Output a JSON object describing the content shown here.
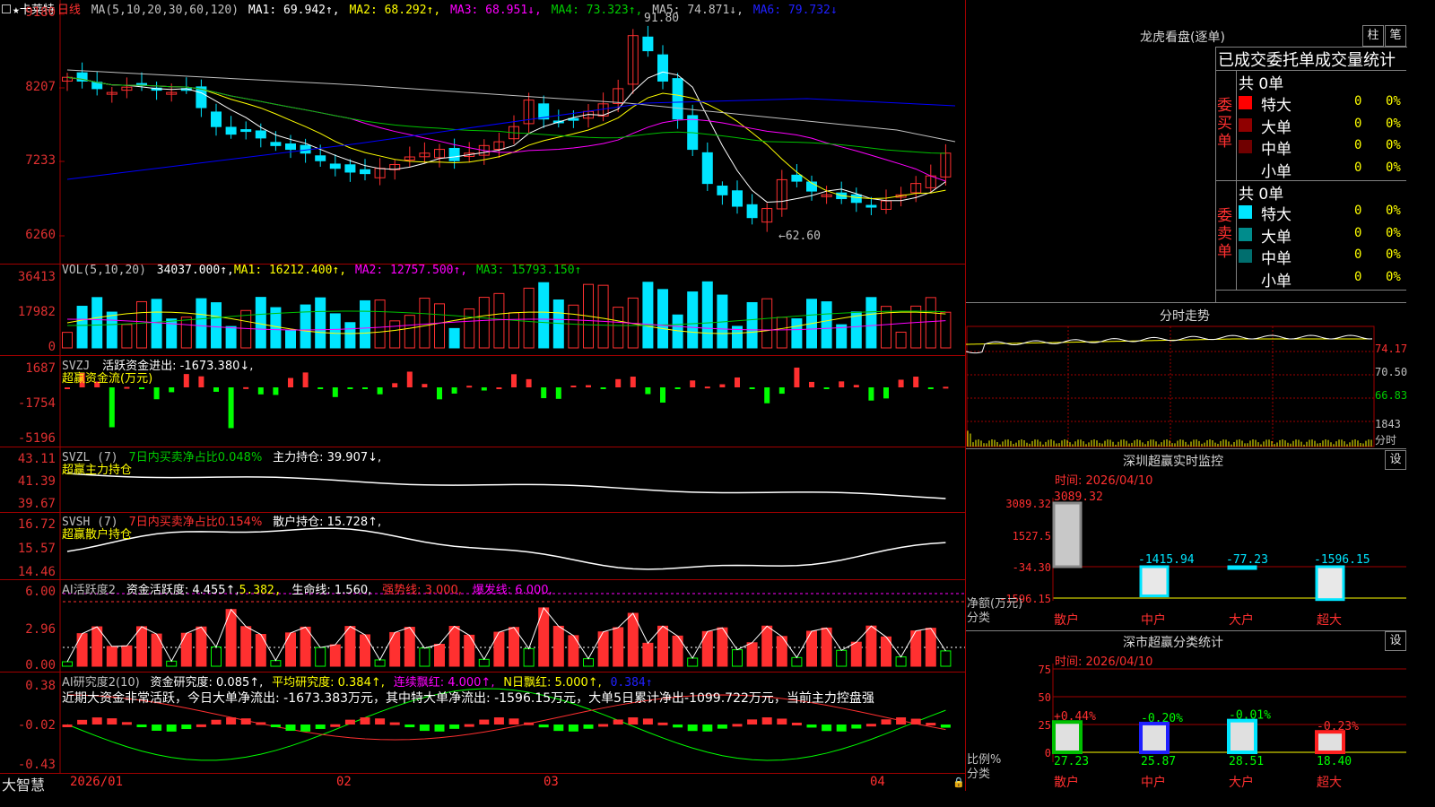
{
  "colors": {
    "up": "#ff3030",
    "down": "#00e5ff",
    "vol_up": "#ff3030",
    "grid": "#a00000",
    "ma1": "#ffffff",
    "ma2": "#ffff00",
    "ma3": "#ff00ff",
    "ma4": "#00c000",
    "ma5": "#c0c0c0",
    "ma6": "#0000ff",
    "green": "#00ff00",
    "yellow": "#ffff00",
    "magenta": "#ff00ff",
    "cyan": "#00e5ff"
  },
  "header": {
    "icon": "square-icon",
    "star": "★",
    "name": "卡莱特",
    "period": "日线",
    "ma_label": "MA(5,10,20,30,60,120)",
    "ma1": "MA1: 69.942↑,",
    "ma2": "MA2: 68.292↑,",
    "ma3": "MA3: 68.951↓,",
    "ma4": "MA4: 73.323↑,",
    "ma5": "MA5: 74.871↓,",
    "ma6": "MA6: 79.732↓"
  },
  "price_axis": {
    "ticks": [
      "9180",
      "8207",
      "7233",
      "6260"
    ]
  },
  "annotations": {
    "high": "91.80",
    "low": "←62.60"
  },
  "vol": {
    "label": "VOL(5,10,20)",
    "value": "34037.000↑,",
    "ma1": "MA1: 16212.400↑,",
    "ma2": "MA2: 12757.500↑,",
    "ma3": "MA3: 15793.150↑",
    "ticks": [
      "36413",
      "17982",
      "0"
    ]
  },
  "svzj": {
    "label": "SVZJ",
    "text": "活跃资金进出: -1673.380↓,",
    "sub": "超赢资金流(万元)",
    "ticks": [
      "1687",
      "-1754",
      "-5196"
    ]
  },
  "svzl": {
    "label": "SVZL (7)",
    "text1": "7日内买卖净占比0.048%",
    "text2": "主力持仓: 39.907↓,",
    "sub": "超赢主力持仓",
    "ticks": [
      "43.11",
      "41.39",
      "39.67"
    ]
  },
  "svsh": {
    "label": "SVSH (7)",
    "text1": "7日内买卖净占比0.154%",
    "text2": "散户持仓: 15.728↑,",
    "sub": "超赢散户持仓",
    "ticks": [
      "16.72",
      "15.57",
      "14.46"
    ]
  },
  "ai2": {
    "label": "AI活跃度2",
    "text1": "资金活跃度: 4.455↑,",
    "text2": "5.382,",
    "text3": "生命线: 1.560,",
    "text4": "强势线: 3.000,",
    "text5": "爆发线: 6.000,",
    "ticks": [
      "6.00",
      "2.96",
      "0.00"
    ]
  },
  "ai_res": {
    "label": "AI研究度2(10)",
    "text1": "资金研究度: 0.085↑,",
    "text2": "平均研究度: 0.384↑,",
    "text3": "连续飘红: 4.000↑,",
    "text4": "N日飘红: 5.000↑,",
    "text5": "0.384↑",
    "comment": "近期大资金非常活跃，今日大单净流出: -1673.383万元，其中特大单净流出: -1596.15万元，大单5日累计净出-1099.722万元，当前主力控盘强",
    "ticks": [
      "0.38",
      "-0.02",
      "-0.43"
    ]
  },
  "footer": {
    "brand": "大智慧",
    "dates": [
      "2026/01",
      "02",
      "03",
      "04"
    ],
    "lock": "lock-icon"
  },
  "lhb": {
    "title": "龙虎看盘(逐单)",
    "btn1": "柱",
    "btn2": "笔",
    "header": "已成交委托单成交量统计",
    "buy_title": "共 0单",
    "buy_side": "委买单",
    "buy_rows": [
      {
        "label": "特大",
        "v": "0",
        "p": "0%",
        "c": "#ff0000"
      },
      {
        "label": "大单",
        "v": "0",
        "p": "0%",
        "c": "#900000"
      },
      {
        "label": "中单",
        "v": "0",
        "p": "0%",
        "c": "#700000"
      },
      {
        "label": "小单",
        "v": "0",
        "p": "0%",
        "c": ""
      }
    ],
    "sell_title": "共 0单",
    "sell_side": "委卖单",
    "sell_rows": [
      {
        "label": "特大",
        "v": "0",
        "p": "0%",
        "c": "#00e5ff"
      },
      {
        "label": "大单",
        "v": "0",
        "p": "0%",
        "c": "#008c8c"
      },
      {
        "label": "中单",
        "v": "0",
        "p": "0%",
        "c": "#006e6e"
      },
      {
        "label": "小单",
        "v": "0",
        "p": "0%",
        "c": ""
      }
    ]
  },
  "intraday": {
    "title": "分时走势",
    "ticks": [
      "74.17",
      "70.50",
      "66.83",
      "1843",
      "分时"
    ]
  },
  "sz_monitor": {
    "title": "深圳超赢实时监控",
    "btn": "设",
    "time": "时间: 2026/04/10",
    "ticks": [
      "3089.32",
      "1527.5",
      "-34.30",
      "-1596.15"
    ],
    "ylabel": "净额(万元)",
    "xlabel": "分类",
    "bars": [
      {
        "cat": "散户",
        "value": 3089.32,
        "label": "3089.32"
      },
      {
        "cat": "中户",
        "value": -1415.94,
        "label": "-1415.94"
      },
      {
        "cat": "大户",
        "value": -77.23,
        "label": "-77.23"
      },
      {
        "cat": "超大",
        "value": -1596.15,
        "label": "-1596.15"
      }
    ]
  },
  "sz_class": {
    "title": "深市超赢分类统计",
    "btn": "设",
    "time": "时间: 2026/04/10",
    "ticks": [
      "75",
      "50",
      "25",
      "0"
    ],
    "ylabel": "比例%",
    "xlabel": "分类",
    "bars": [
      {
        "cat": "散户",
        "value": 27.23,
        "top": "+0.44%",
        "c": "#00c000"
      },
      {
        "cat": "中户",
        "value": 25.87,
        "top": "-0.20%",
        "c": "#2020ff"
      },
      {
        "cat": "大户",
        "value": 28.51,
        "top": "-0.01%",
        "c": "#00e5ff"
      },
      {
        "cat": "超大",
        "value": 18.4,
        "top": "-0.23%",
        "c": "#ff2020"
      }
    ],
    "bottom": [
      "27.23",
      "25.87",
      "28.51",
      "18.40"
    ]
  }
}
